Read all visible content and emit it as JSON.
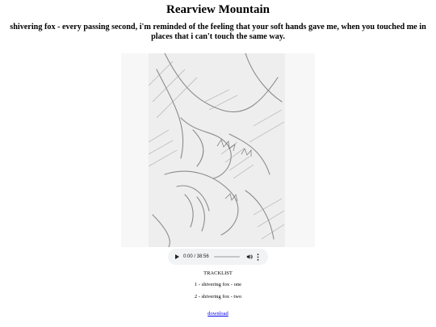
{
  "page": {
    "title": "Rearview Mountain",
    "subtitle": "shivering fox - every passing second, i'm reminded of the feeling that your soft hands gave me, when you touched me in places that i can't touch the same way."
  },
  "cover": {
    "icon": "pencil-sketch-artwork"
  },
  "player": {
    "time": "0:00 / 38:56",
    "progress": 0,
    "icons": [
      "play-icon",
      "volume-icon",
      "more-options-icon"
    ]
  },
  "tracklist": {
    "heading": "TRACKLIST",
    "tracks": [
      "1 - shivering fox - one",
      "2 - shivering fox - two"
    ]
  },
  "download": {
    "label": "download"
  }
}
